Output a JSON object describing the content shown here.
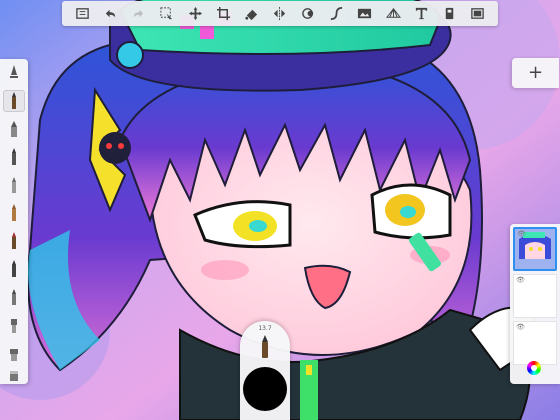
{
  "toolbar": {
    "icons": [
      "gallery-icon",
      "undo-icon",
      "redo-icon",
      "select-icon",
      "transform-icon",
      "crop-icon",
      "fill-icon",
      "symmetry-icon",
      "stamp-icon",
      "curve-icon",
      "image-icon",
      "perspective-icon",
      "text-icon",
      "layer-mask-icon",
      "fullscreen-icon"
    ]
  },
  "brush_panel": {
    "selected_index": 1,
    "brushes": [
      "ruler",
      "pencil",
      "marker",
      "pen",
      "airbrush",
      "calligraphy",
      "paintbrush",
      "ink",
      "fineliner",
      "wet-brush",
      "smudge",
      "eraser"
    ]
  },
  "layers": {
    "add_label": "+",
    "items": [
      {
        "name": "artwork-layer",
        "active": true
      },
      {
        "name": "blank-layer",
        "active": false
      },
      {
        "name": "background-layer",
        "active": false
      }
    ]
  },
  "brush_size": {
    "value": "13.7"
  },
  "current_color": "#000000"
}
